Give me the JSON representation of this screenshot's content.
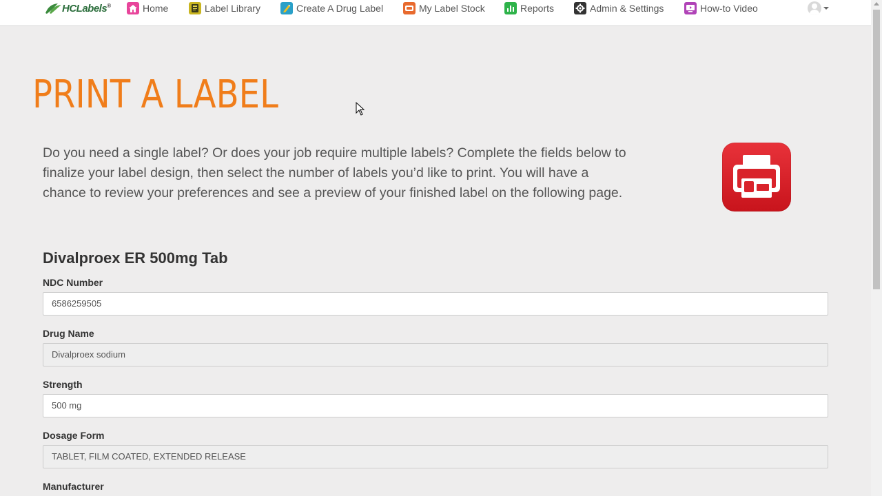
{
  "brand": {
    "logo_text": "HCLabels",
    "reg_mark": "®"
  },
  "nav": {
    "items": [
      {
        "label": "Home",
        "icon": "home-icon",
        "color": "#e8459b"
      },
      {
        "label": "Label Library",
        "icon": "library-icon",
        "color": "#c9b520"
      },
      {
        "label": "Create A Drug Label",
        "icon": "create-label-icon",
        "color": "#2aa0c8"
      },
      {
        "label": "My Label Stock",
        "icon": "label-stock-icon",
        "color": "#e86a2e"
      },
      {
        "label": "Reports",
        "icon": "reports-icon",
        "color": "#2eb34a"
      },
      {
        "label": "Admin & Settings",
        "icon": "gear-icon",
        "color": "#333333"
      },
      {
        "label": "How-to Video",
        "icon": "video-icon",
        "color": "#b043b7"
      }
    ]
  },
  "page": {
    "title": "PRINT A LABEL",
    "intro": "Do you need a single label? Or does your job require multiple labels? Complete the fields below to finalize your label design, then select the number of labels you’d like to print. You will have a chance to review your preferences and see a preview of your finished label on the following page.",
    "drug_heading": "Divalproex ER 500mg Tab"
  },
  "form": {
    "ndc": {
      "label": "NDC Number",
      "value": "6586259505"
    },
    "drug_name": {
      "label": "Drug Name",
      "value": "Divalproex sodium"
    },
    "strength": {
      "label": "Strength",
      "value": "500 mg"
    },
    "dosage_form": {
      "label": "Dosage Form",
      "value": "TABLET, FILM COATED, EXTENDED RELEASE"
    },
    "manufacturer": {
      "label": "Manufacturer"
    }
  },
  "colors": {
    "accent": "#f07d1a",
    "print_icon": "#d9232b"
  }
}
